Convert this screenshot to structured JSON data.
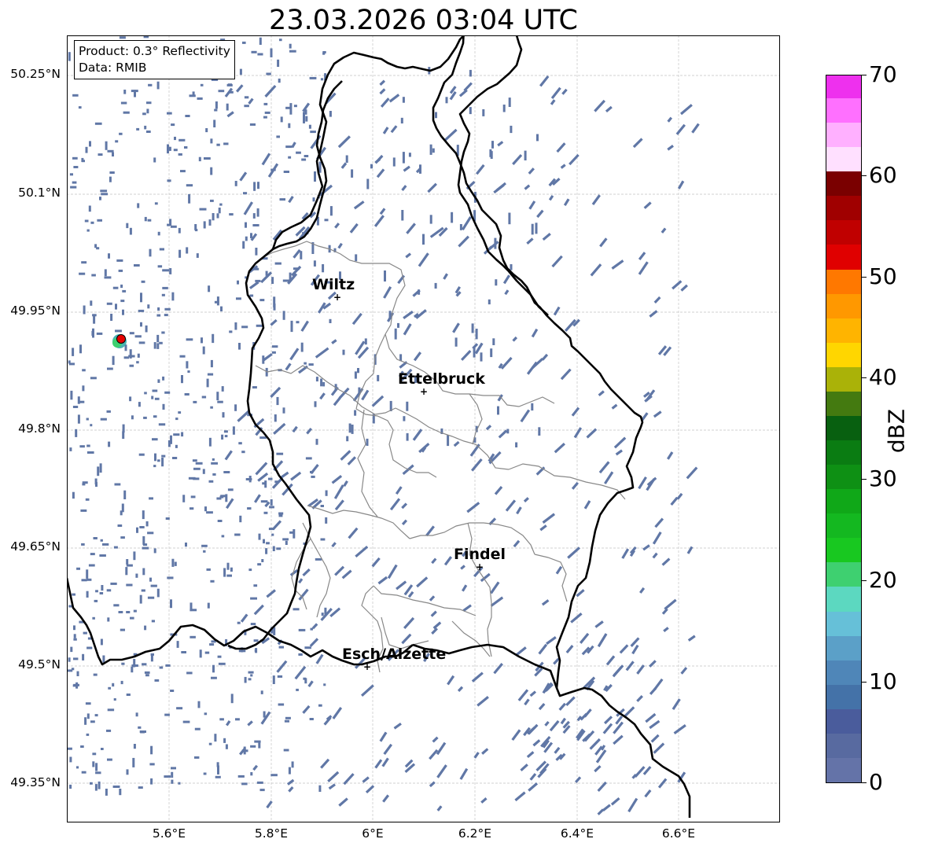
{
  "title": "23.03.2026 03:04 UTC",
  "info": {
    "product": "Product: 0.3° Reflectivity",
    "data": "Data: RMIB"
  },
  "lat_labels": [
    "50.25°N",
    "50.1°N",
    "49.95°N",
    "49.8°N",
    "49.65°N",
    "49.5°N",
    "49.35°N"
  ],
  "lon_labels": [
    "5.6°E",
    "5.8°E",
    "6°E",
    "6.2°E",
    "6.4°E",
    "6.6°E"
  ],
  "cities": [
    {
      "name": "Wiltz"
    },
    {
      "name": "Ettelbruck"
    },
    {
      "name": "Findel"
    },
    {
      "name": "Esch/Alzette"
    }
  ],
  "colorbar": {
    "label": "dBZ",
    "ticks": [
      "0",
      "10",
      "20",
      "30",
      "40",
      "50",
      "60",
      "70"
    ],
    "min": 0,
    "max": 70,
    "step": 2.5,
    "colors": [
      "#6473a8",
      "#586aa0",
      "#4a5c9c",
      "#4472a8",
      "#4f86b8",
      "#5ba0c8",
      "#66c0d8",
      "#5cd8c0",
      "#3ed070",
      "#18c820",
      "#14b820",
      "#10a818",
      "#0e9014",
      "#0a7c12",
      "#086010",
      "#447a10",
      "#aab208",
      "#ffd600",
      "#ffb400",
      "#ff9800",
      "#ff7800",
      "#e00000",
      "#c00000",
      "#a00000",
      "#7a0000",
      "#ffe0ff",
      "#ffb0ff",
      "#ff70ff",
      "#ee30ee"
    ]
  },
  "map": {
    "lon_range": [
      5.4,
      6.8
    ],
    "lat_range": [
      49.3,
      50.3
    ],
    "echo_color": "#6077a6",
    "border_color": "#000000",
    "district_color": "#888888",
    "grid": true,
    "radar_site_color": "#ff0000"
  }
}
